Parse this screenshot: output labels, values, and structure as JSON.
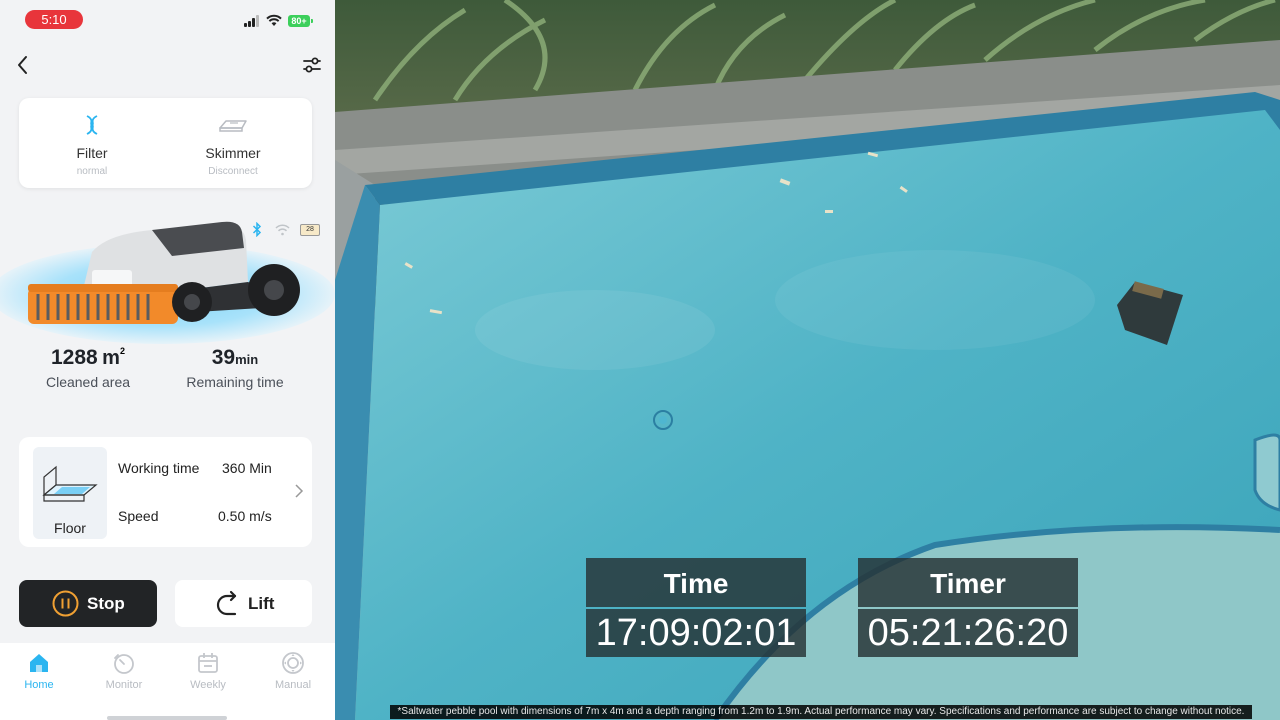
{
  "status_bar": {
    "time": "5:10",
    "battery": "80+"
  },
  "status_card": {
    "filter": {
      "title": "Filter",
      "state": "normal"
    },
    "skimmer": {
      "title": "Skimmer",
      "state": "Disconnect"
    }
  },
  "robot": {
    "battery_level": "28"
  },
  "metrics": {
    "area_value": "1288",
    "area_unit": "m",
    "area_sup": "2",
    "area_label": "Cleaned area",
    "time_value": "39",
    "time_unit": "min",
    "time_label": "Remaining time"
  },
  "mode_card": {
    "mode_name": "Floor",
    "working_time_label": "Working time",
    "working_time_value": "360 Min",
    "speed_label": "Speed",
    "speed_value": "0.50 m/s"
  },
  "buttons": {
    "stop": "Stop",
    "lift": "Lift"
  },
  "tabs": [
    {
      "label": "Home",
      "icon": "home-icon",
      "active": true
    },
    {
      "label": "Monitor",
      "icon": "monitor-icon",
      "active": false
    },
    {
      "label": "Weekly",
      "icon": "calendar-icon",
      "active": false
    },
    {
      "label": "Manual",
      "icon": "manual-icon",
      "active": false
    }
  ],
  "overlay": {
    "time_title": "Time",
    "time_value": "17:09:02:01",
    "timer_title": "Timer",
    "timer_value": "05:21:26:20"
  },
  "caption": "*Saltwater pebble pool with dimensions of 7m x 4m and a depth ranging from 1.2m to 1.9m. Actual performance may vary. Specifications and performance are subject to change without notice.",
  "colors": {
    "accent": "#2bb5f0",
    "stop_ring": "#f0a033",
    "stop_bg": "#222426",
    "pill": "#e8353b",
    "battery": "#3ccf5b"
  }
}
